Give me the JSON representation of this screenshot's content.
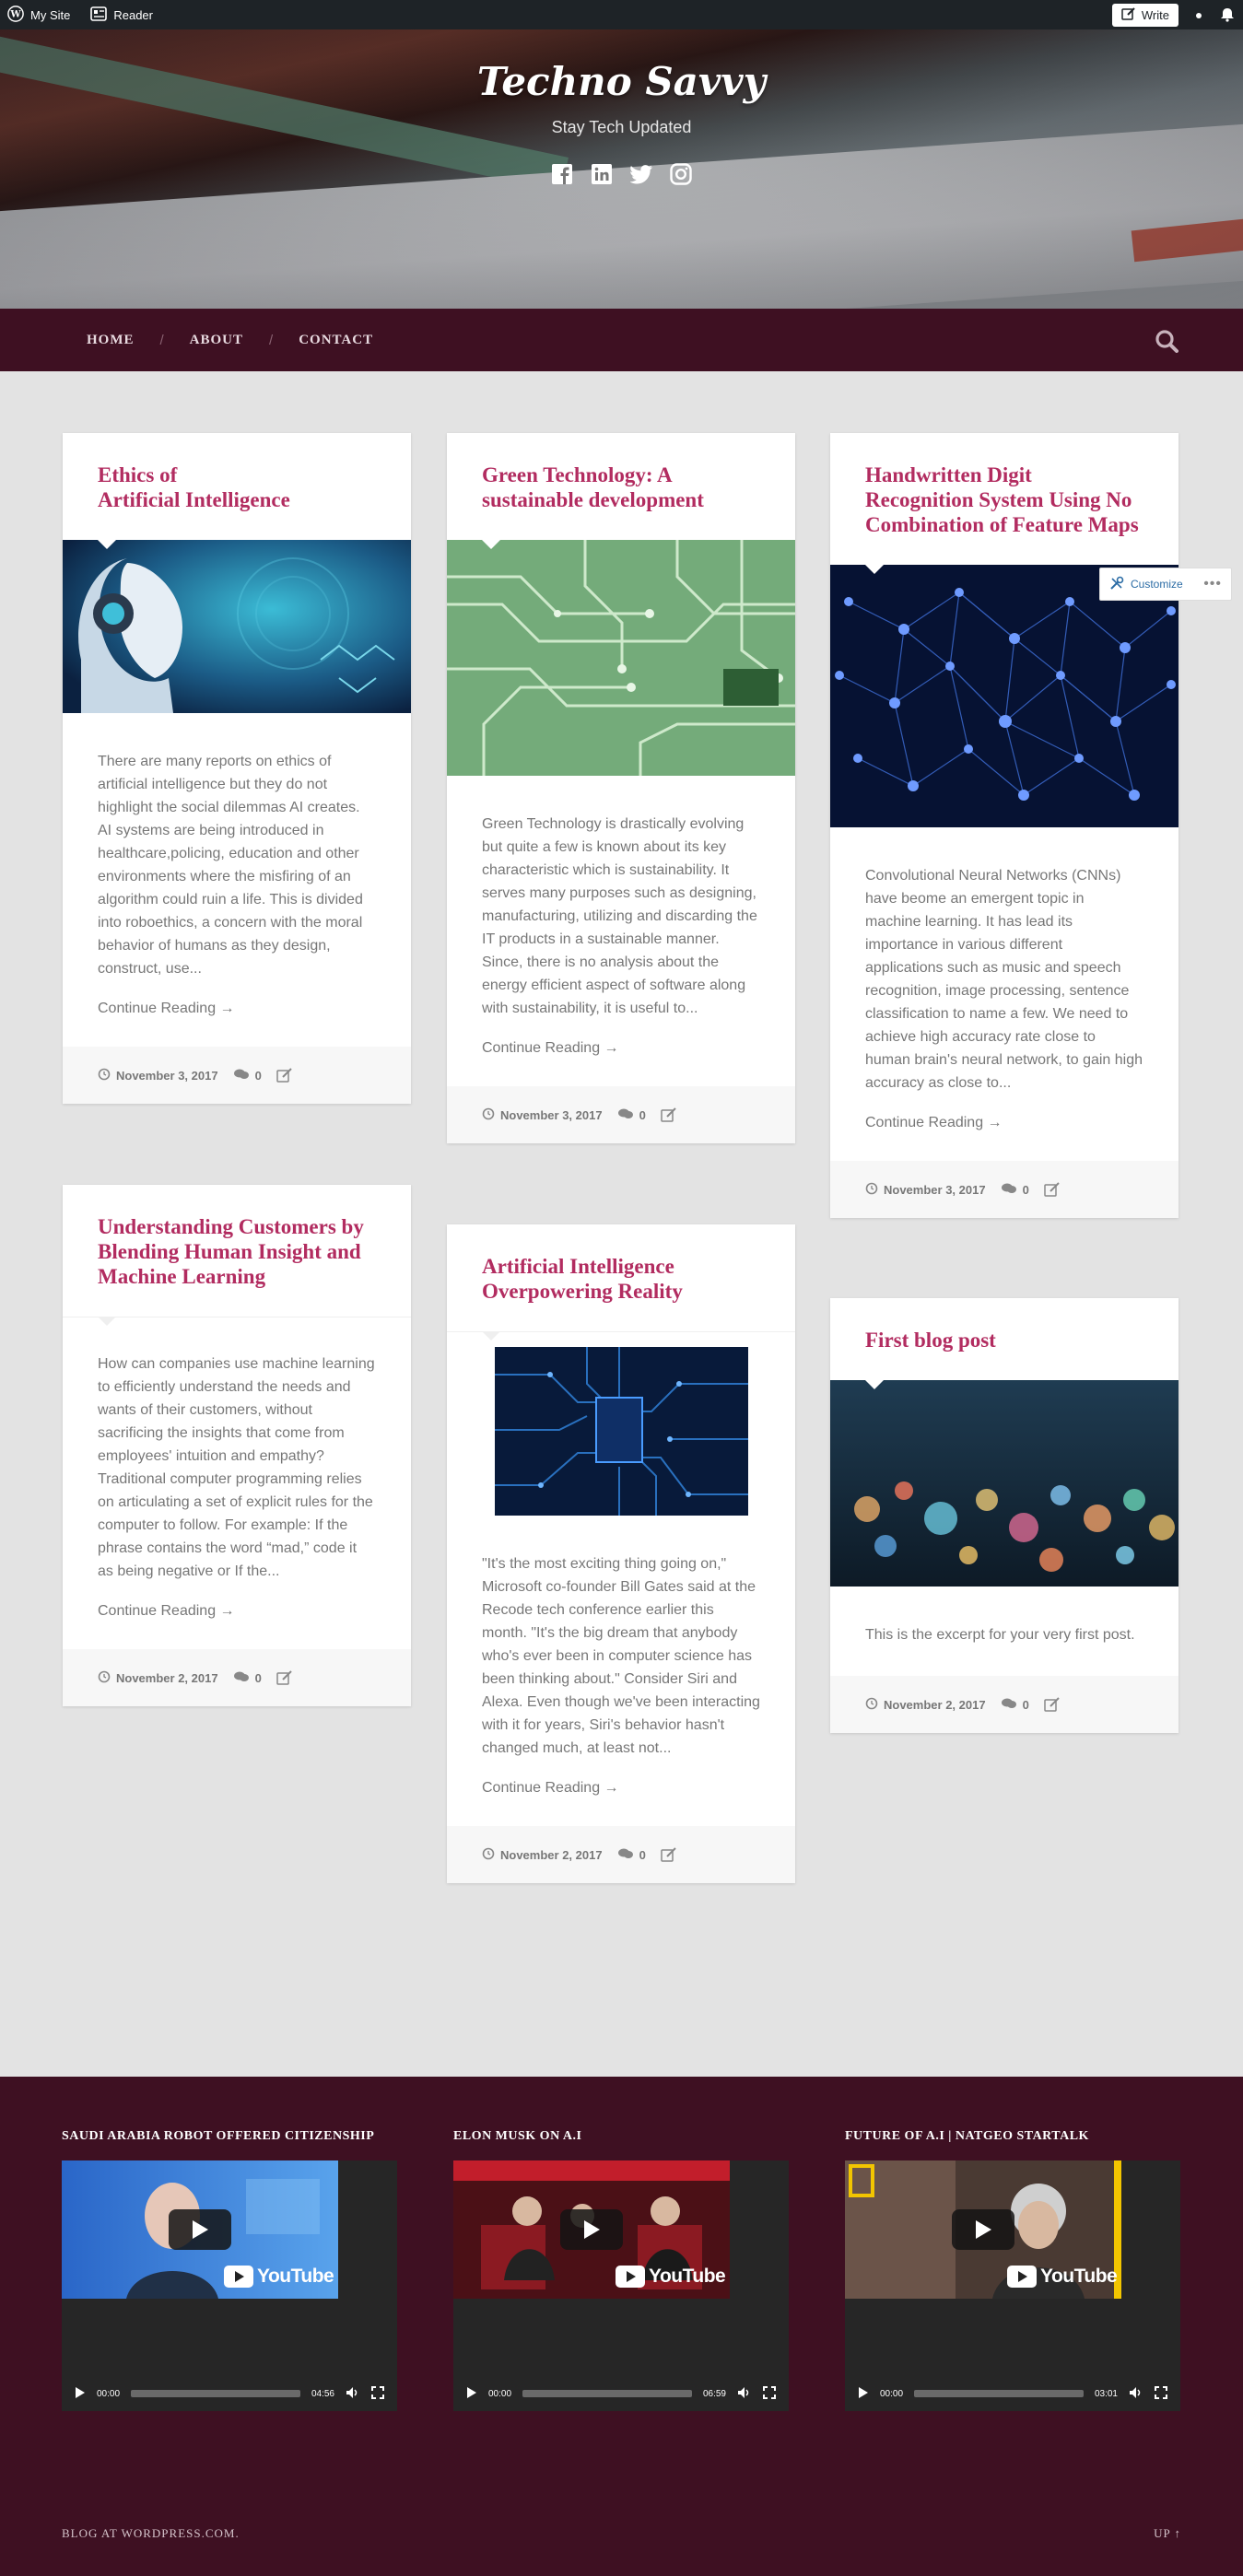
{
  "adminbar": {
    "my_site": "My Site",
    "reader": "Reader",
    "write": "Write"
  },
  "header": {
    "site_title": "Techno Savvy",
    "tagline": "Stay Tech Updated"
  },
  "social_icons": [
    "facebook-icon",
    "linkedin-icon",
    "twitter-icon",
    "instagram-icon"
  ],
  "nav": {
    "items": [
      "HOME",
      "ABOUT",
      "CONTACT"
    ],
    "separator": "/"
  },
  "customize": {
    "label": "Customize"
  },
  "posts": [
    {
      "title": "Ethics of\nArtificial Intelligence",
      "excerpt": "There are many reports on ethics of artificial intelligence but they do not highlight the social dilemmas AI creates. AI systems are being introduced in healthcare,policing, education and other environments where the misfiring of an algorithm could ruin a life. This is divided into roboethics, a concern with the moral behavior of humans as they design, construct, use...",
      "more": "Continue Reading →",
      "date": "November 3, 2017",
      "comments": "0"
    },
    {
      "title": "Green Technology: A sustainable development",
      "excerpt": "Green Technology is drastically evolving but quite a few is known about its key characteristic which is sustainability. It serves many purposes such as designing, manufacturing, utilizing and discarding the IT products in a sustainable manner. Since, there is no analysis about the energy efficient aspect of software along with sustainability, it is useful to...",
      "more": "Continue Reading →",
      "date": "November 3, 2017",
      "comments": "0"
    },
    {
      "title": "Handwritten Digit Recognition System Using No Combination of Feature Maps",
      "excerpt": "Convolutional Neural Networks (CNNs) have beome an emergent topic in machine learning. It has lead its importance in various different applications such as music and speech recognition, image processing, sentence classification to name a few. We need to achieve high accuracy rate close to human brain's neural network, to gain high accuracy as close to...",
      "more": "Continue Reading →",
      "date": "November 3, 2017",
      "comments": "0"
    },
    {
      "title": "Understanding Customers by Blending Human Insight and Machine Learning",
      "excerpt": "How can companies use machine learning to efficiently understand the needs and wants of their customers, without sacrificing the insights that come from employees' intuition and empathy? Traditional computer programming relies on articulating a set of explicit rules for the computer to follow. For example:  If the phrase contains the word “mad,” code it as being negative or If the...",
      "more": "Continue Reading →",
      "date": "November 2, 2017",
      "comments": "0"
    },
    {
      "title": "Artificial Intelligence Overpowering Reality",
      "excerpt": "\"It's the most exciting thing going on,\" Microsoft co-founder Bill Gates said at the Recode tech conference earlier this month. \"It's the big dream that anybody who's ever been in computer science has been thinking about.\" Consider Siri and Alexa. Even though we've been interacting with it for years, Siri's behavior hasn't changed much, at least not...",
      "more": "Continue Reading →",
      "date": "November 2, 2017",
      "comments": "0"
    },
    {
      "title": "First blog post",
      "excerpt": "This is the excerpt for your very first post.",
      "date": "November 2, 2017",
      "comments": "0"
    }
  ],
  "widgets": [
    {
      "title": "SAUDI ARABIA ROBOT OFFERED CITIZENSHIP",
      "current": "00:00",
      "duration": "04:56",
      "logo": "YouTube"
    },
    {
      "title": "ELON MUSK ON A.I",
      "current": "00:00",
      "duration": "06:59",
      "logo": "YouTube"
    },
    {
      "title": "FUTURE OF A.I | NATGEO STARTALK",
      "current": "00:00",
      "duration": "03:01",
      "logo": "YouTube"
    }
  ],
  "footer": {
    "credit": "BLOG AT WORDPRESS.COM.",
    "up": "UP ↑"
  }
}
